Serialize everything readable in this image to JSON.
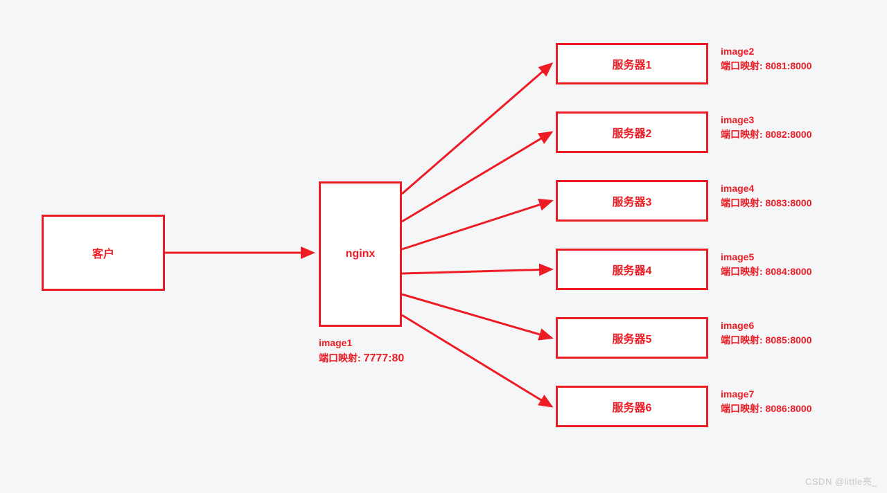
{
  "client": {
    "label": "客户"
  },
  "nginx": {
    "label": "nginx",
    "image": "image1",
    "port_prefix": "端口映射: ",
    "port": "7777:80"
  },
  "servers": [
    {
      "label": "服务器1",
      "image": "image2",
      "port_mapping": "端口映射: 8081:8000"
    },
    {
      "label": "服务器2",
      "image": "image3",
      "port_mapping": "端口映射: 8082:8000"
    },
    {
      "label": "服务器3",
      "image": "image4",
      "port_mapping": "端口映射: 8083:8000"
    },
    {
      "label": "服务器4",
      "image": "image5",
      "port_mapping": "端口映射: 8084:8000"
    },
    {
      "label": "服务器5",
      "image": "image6",
      "port_mapping": "端口映射: 8085:8000"
    },
    {
      "label": "服务器6",
      "image": "image7",
      "port_mapping": "端口映射: 8086:8000"
    }
  ],
  "watermark": "CSDN @little亮_"
}
